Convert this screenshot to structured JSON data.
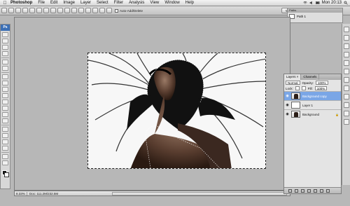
{
  "menubar": {
    "apple": "",
    "items": [
      "Photoshop",
      "File",
      "Edit",
      "Image",
      "Layer",
      "Select",
      "Filter",
      "Analysis",
      "View",
      "Window",
      "Help"
    ],
    "clock": "Mon 20:13"
  },
  "options": {
    "auto_add_label": "Auto-Add/Delete",
    "workspace_label": "Workspace"
  },
  "paths_panel": {
    "tab": "Paths",
    "item": "Path 1"
  },
  "tools": {
    "app_badge": "Ps"
  },
  "status": {
    "zoom": "8.33%",
    "doc_info": "Doc: 111.2M/232.5M"
  },
  "layers_panel": {
    "tabs": [
      "Layers ×",
      "Channels"
    ],
    "blend_mode": "Normal",
    "opacity_label": "Opacity:",
    "opacity_value": "100%",
    "lock_label": "Lock:",
    "fill_label": "Fill:",
    "fill_value": "100%",
    "layers": [
      {
        "name": "Background copy",
        "selected": true
      },
      {
        "name": "Layer 1",
        "selected": false
      },
      {
        "name": "Background",
        "selected": false
      }
    ]
  },
  "colors": {
    "accent_selected": "#7aa6e6",
    "app_blue": "#3b6fb5"
  }
}
